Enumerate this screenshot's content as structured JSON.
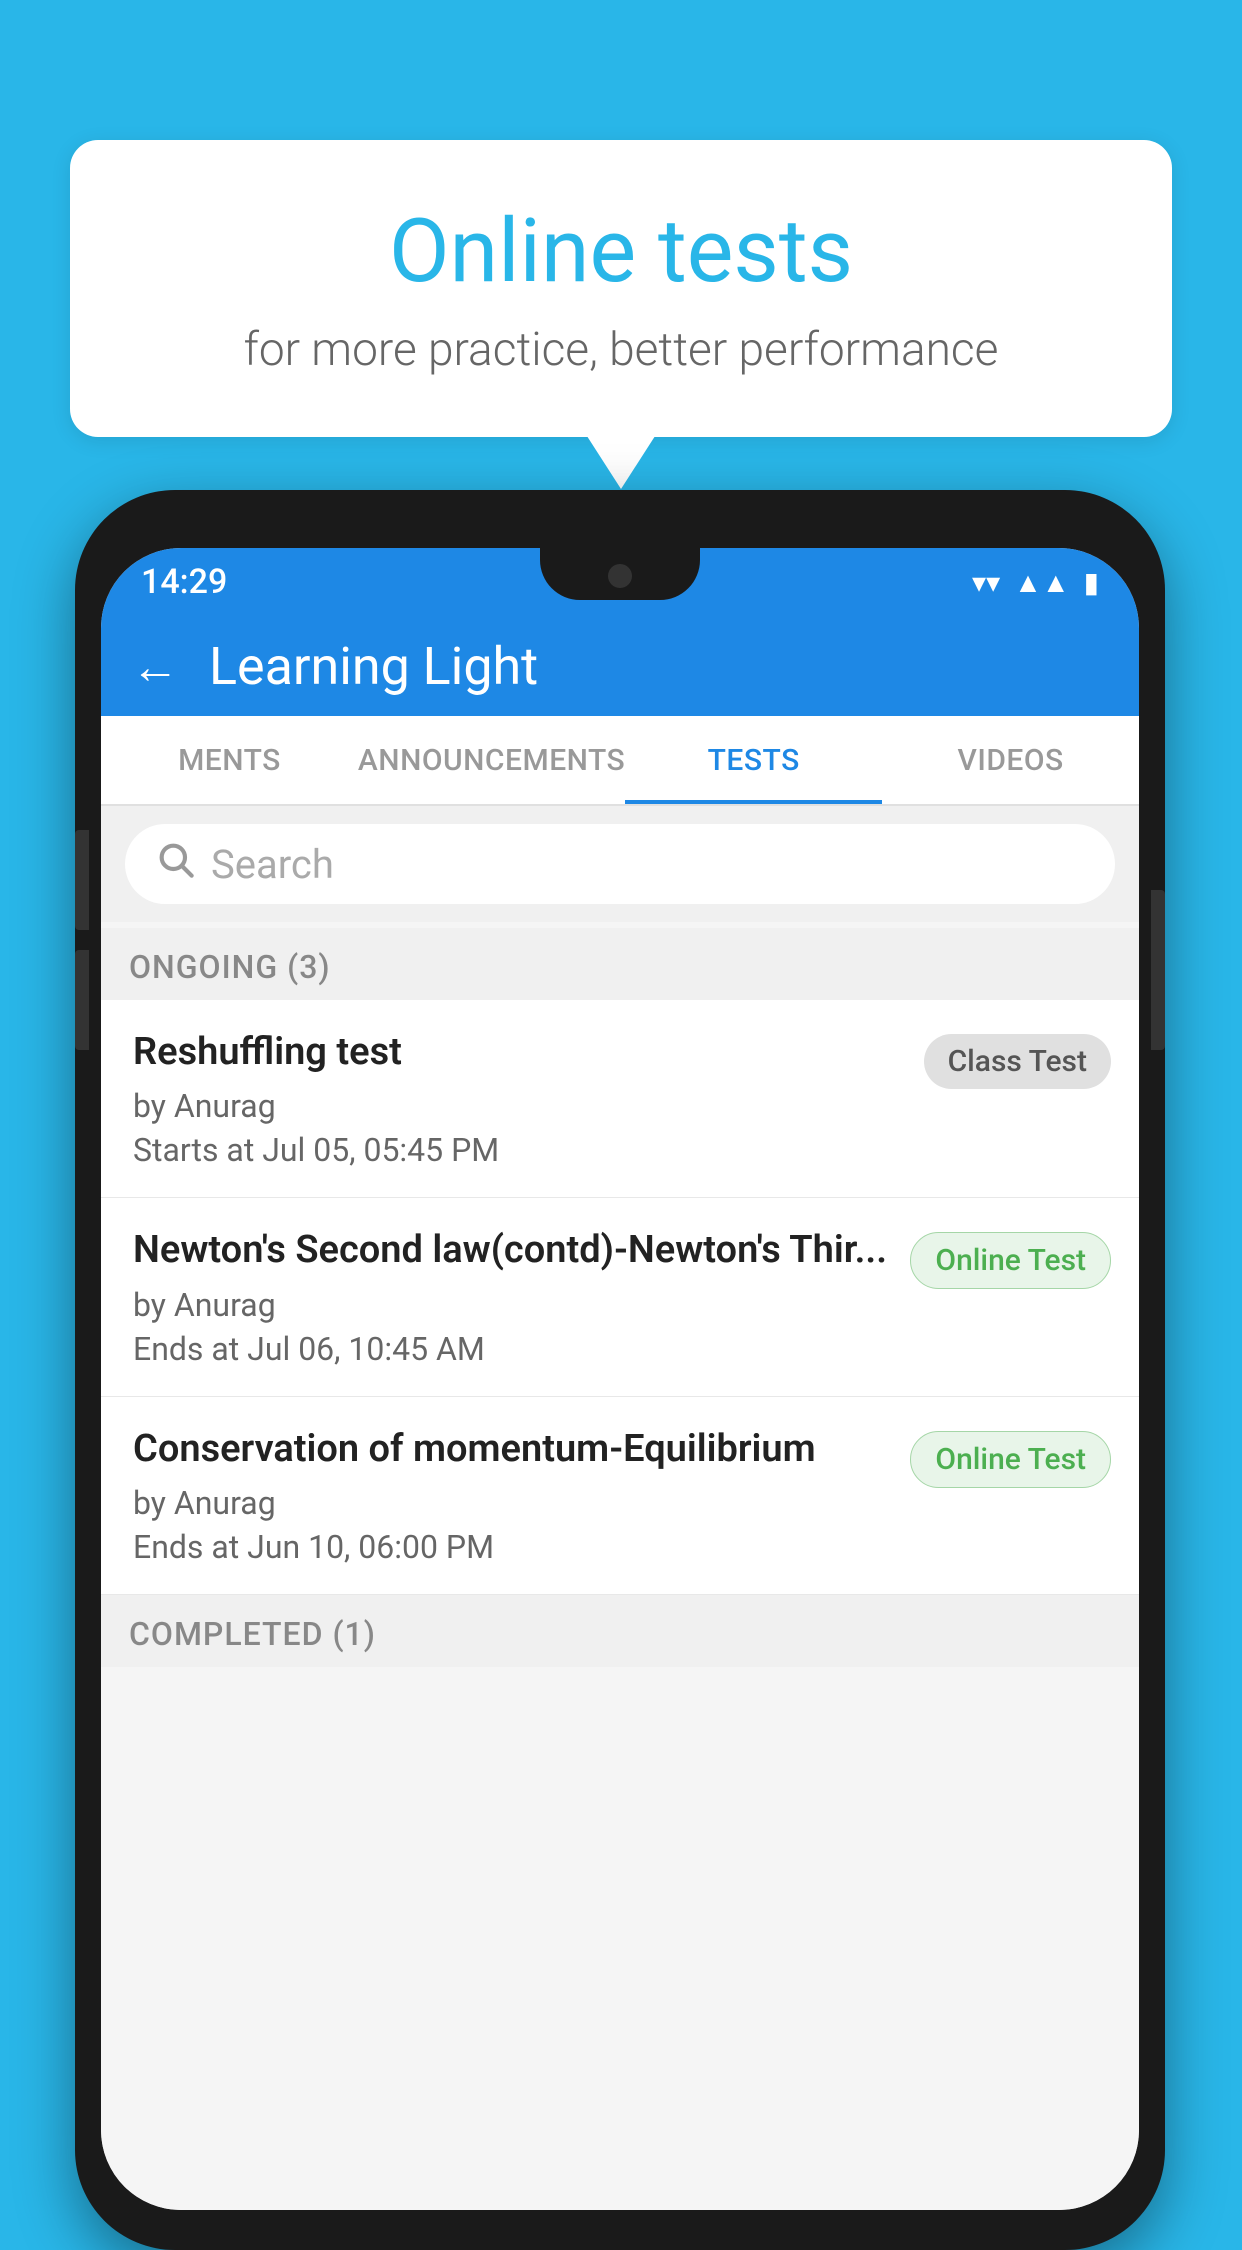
{
  "background_color": "#29b6e8",
  "speech_bubble": {
    "title": "Online tests",
    "subtitle": "for more practice, better performance"
  },
  "phone": {
    "status_bar": {
      "time": "14:29",
      "icons": [
        "wifi",
        "signal",
        "battery"
      ]
    },
    "app_bar": {
      "back_label": "←",
      "title": "Learning Light"
    },
    "tabs": [
      {
        "label": "MENTS",
        "active": false
      },
      {
        "label": "ANNOUNCEMENTS",
        "active": false
      },
      {
        "label": "TESTS",
        "active": true
      },
      {
        "label": "VIDEOS",
        "active": false
      }
    ],
    "search": {
      "placeholder": "Search",
      "icon": "🔍"
    },
    "sections": [
      {
        "label": "ONGOING (3)",
        "tests": [
          {
            "title": "Reshuffling test",
            "author": "by Anurag",
            "time": "Starts at  Jul 05, 05:45 PM",
            "badge": "Class Test",
            "badge_type": "class"
          },
          {
            "title": "Newton's Second law(contd)-Newton's Thir...",
            "author": "by Anurag",
            "time": "Ends at  Jul 06, 10:45 AM",
            "badge": "Online Test",
            "badge_type": "online"
          },
          {
            "title": "Conservation of momentum-Equilibrium",
            "author": "by Anurag",
            "time": "Ends at  Jun 10, 06:00 PM",
            "badge": "Online Test",
            "badge_type": "online"
          }
        ]
      },
      {
        "label": "COMPLETED (1)",
        "tests": []
      }
    ]
  }
}
